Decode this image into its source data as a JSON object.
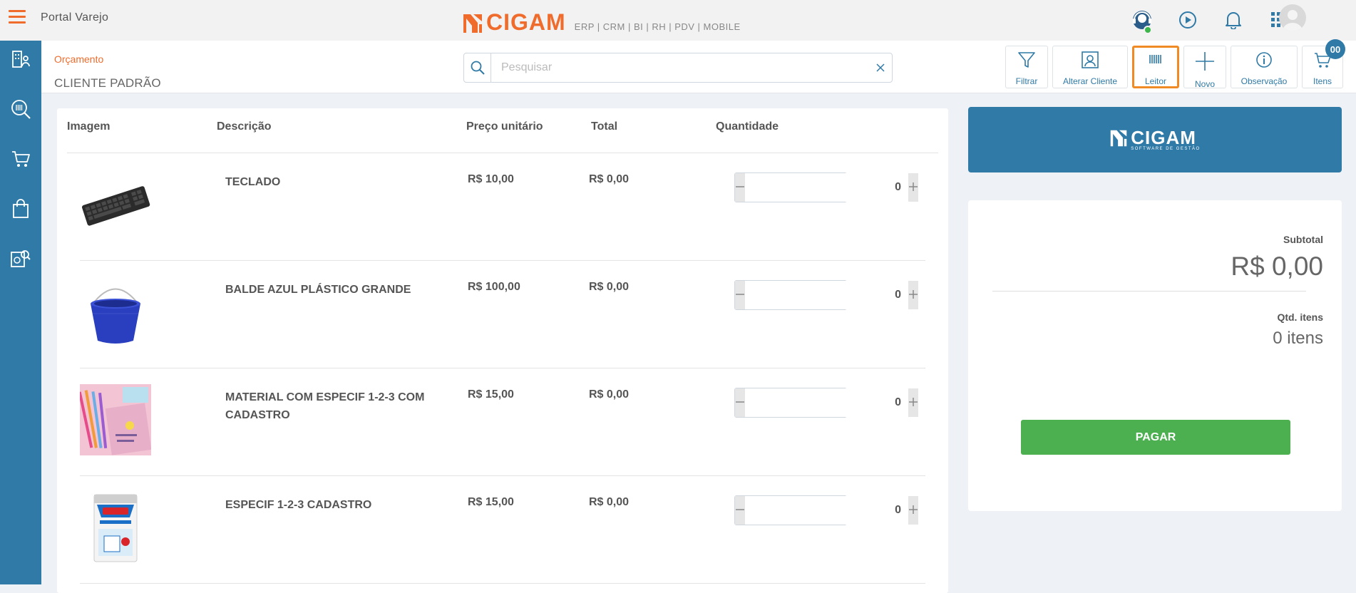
{
  "app": {
    "title": "Portal Varejo",
    "brand": "CIGAM",
    "brand_modules": "ERP | CRM | BI | RH | PDV | MOBILE",
    "accent_color": "#ef6c2c",
    "primary_color": "#2f7aa6"
  },
  "top_icons": [
    "support-agent-icon",
    "play-icon",
    "bell-icon",
    "apps-grid-icon"
  ],
  "sidebar": {
    "items": [
      {
        "icon": "building-user-icon"
      },
      {
        "icon": "barcode-search-icon"
      },
      {
        "icon": "cart-icon"
      },
      {
        "icon": "shopping-bag-icon"
      },
      {
        "icon": "report-search-icon"
      }
    ]
  },
  "subheader": {
    "breadcrumb": "Orçamento",
    "client": "CLIENTE PADRÃO",
    "search_placeholder": "Pesquisar",
    "search_value": ""
  },
  "toolbar": {
    "filter": "Filtrar",
    "change_client": "Alterar Cliente",
    "reader": "Leitor",
    "new": "Novo",
    "note": "Observação",
    "items": "Itens",
    "items_badge": "00"
  },
  "table": {
    "columns": [
      "Imagem",
      "Descrição",
      "Preço unitário",
      "Total",
      "Quantidade"
    ],
    "rows": [
      {
        "name": "TECLADO",
        "price": "R$ 10,00",
        "total": "R$ 0,00",
        "qty": "0",
        "image": "keyboard"
      },
      {
        "name": "BALDE AZUL PLÁSTICO GRANDE",
        "price": "R$ 100,00",
        "total": "R$ 0,00",
        "qty": "0",
        "image": "bucket"
      },
      {
        "name": "MATERIAL COM ESPECIF 1-2-3 COM CADASTRO",
        "price": "R$ 15,00",
        "total": "R$ 0,00",
        "qty": "0",
        "image": "stationery"
      },
      {
        "name": "ESPECIF 1-2-3 CADASTRO",
        "price": "R$ 15,00",
        "total": "R$ 0,00",
        "qty": "0",
        "image": "paint-can"
      }
    ]
  },
  "banner": {
    "name": "CIGAM",
    "tagline": "SOFTWARE DE GESTÃO"
  },
  "summary": {
    "subtotal_label": "Subtotal",
    "subtotal_value": "R$ 0,00",
    "qty_label": "Qtd. itens",
    "qty_value": "0 itens",
    "pay_label": "PAGAR"
  }
}
